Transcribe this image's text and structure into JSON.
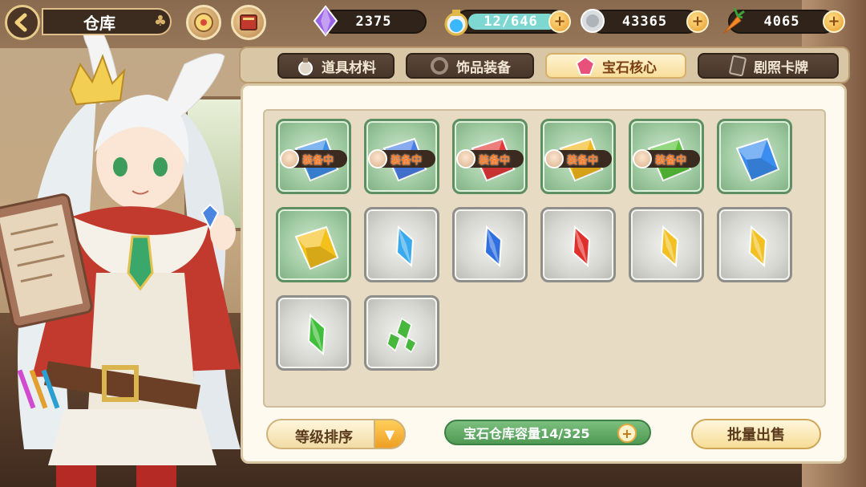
{
  "header": {
    "title": "仓库"
  },
  "resources": [
    {
      "name": "purple-crystal",
      "value": "2375",
      "has_plus": false
    },
    {
      "name": "stamina-potion",
      "value": "12/646",
      "has_plus": true
    },
    {
      "name": "silver-coin",
      "value": "43365",
      "has_plus": true
    },
    {
      "name": "carrot",
      "value": "4065",
      "has_plus": true
    }
  ],
  "tabs": [
    {
      "label": "道具材料",
      "icon": "potion-icon",
      "active": false
    },
    {
      "label": "饰品装备",
      "icon": "ring-icon",
      "active": false
    },
    {
      "label": "宝石核心",
      "icon": "gem-icon",
      "active": true
    },
    {
      "label": "剧照卡牌",
      "icon": "card-icon",
      "active": false
    }
  ],
  "inventory": {
    "equipped_label": "装备中",
    "items": [
      {
        "gem": "blue-diamond",
        "color": "#3f8fe8",
        "frame": "green",
        "equipped": true
      },
      {
        "gem": "blue-diamond",
        "color": "#4a7ee6",
        "frame": "green",
        "equipped": true
      },
      {
        "gem": "red-diamond",
        "color": "#e23a3a",
        "frame": "green",
        "equipped": true
      },
      {
        "gem": "yellow-diamond",
        "color": "#f2b81c",
        "frame": "green",
        "equipped": true
      },
      {
        "gem": "green-diamond",
        "color": "#5ac43a",
        "frame": "green",
        "equipped": true
      },
      {
        "gem": "blue-diamond",
        "color": "#3b8ef0",
        "frame": "green",
        "equipped": false
      },
      {
        "gem": "yellow-diamond",
        "color": "#f4c01c",
        "frame": "green",
        "equipped": false
      },
      {
        "gem": "cyan-shard",
        "color": "#39a9ee",
        "frame": "gray",
        "equipped": false
      },
      {
        "gem": "blue-shard",
        "color": "#2f6fe0",
        "frame": "gray",
        "equipped": false
      },
      {
        "gem": "red-shard",
        "color": "#e0302c",
        "frame": "gray",
        "equipped": false
      },
      {
        "gem": "yellow-shard",
        "color": "#f2c020",
        "frame": "gray",
        "equipped": false
      },
      {
        "gem": "yellow-shard",
        "color": "#f2c020",
        "frame": "gray",
        "equipped": false
      },
      {
        "gem": "green-shard",
        "color": "#3fbf3a",
        "frame": "gray",
        "equipped": false
      },
      {
        "gem": "green-fragments",
        "color": "#47b83c",
        "frame": "gray",
        "equipped": false
      }
    ]
  },
  "footer": {
    "sort_label": "等级排序",
    "capacity_label": "宝石仓库容量14/325",
    "sell_label": "批量出售"
  }
}
